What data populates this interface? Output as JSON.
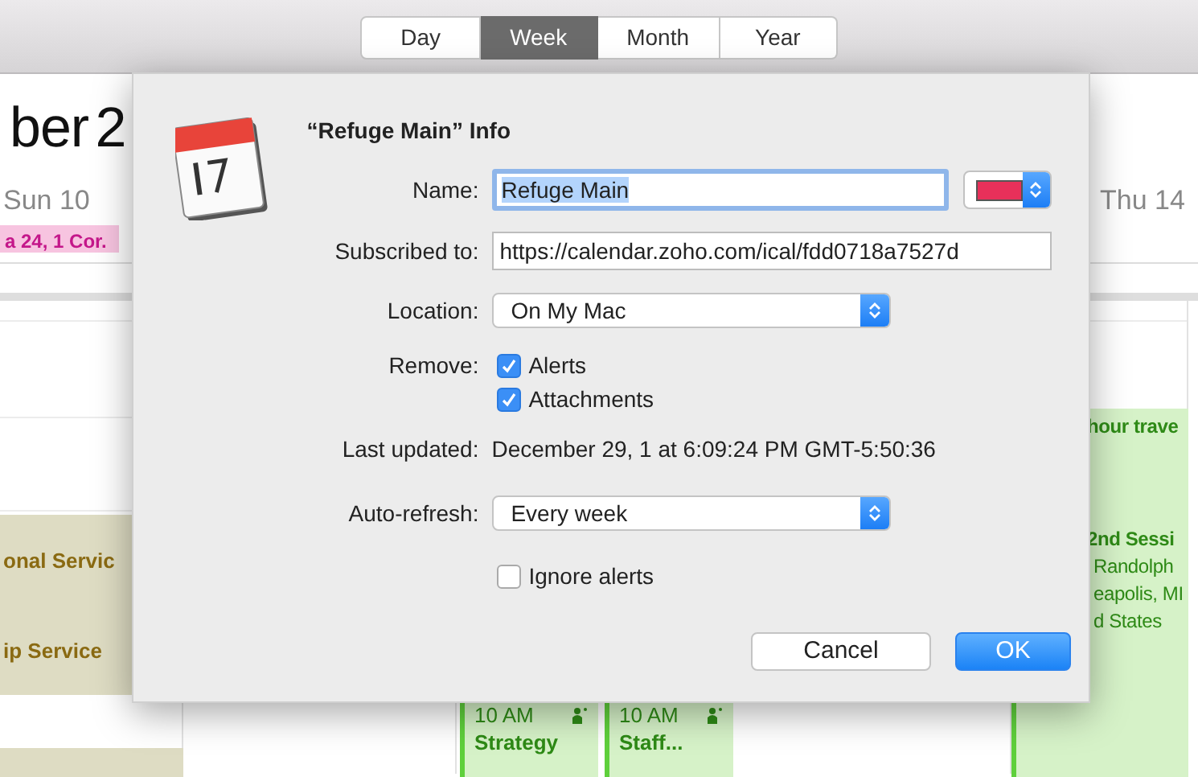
{
  "toolbar": {
    "view_tabs": [
      {
        "label": "Day",
        "selected": false
      },
      {
        "label": "Week",
        "selected": true
      },
      {
        "label": "Month",
        "selected": false
      },
      {
        "label": "Year",
        "selected": false
      }
    ]
  },
  "calendar": {
    "title": "ber 2",
    "columns": [
      {
        "heading": "Sun 10",
        "all_day": [
          {
            "title": "a 24, 1 Cor.",
            "color": "#f7c4e0"
          }
        ],
        "events": [
          {
            "title": "onal Servic",
            "color": "#dedcc3"
          },
          {
            "title": "ip Service",
            "color": "#dedcc3"
          },
          {
            "color": "#dedcc3"
          }
        ]
      },
      {},
      {
        "events": [
          {
            "time": "10 AM",
            "title": "Strategy",
            "color": "#d6f2c8"
          },
          {
            "time": "10 AM",
            "title": "Staff...",
            "color": "#d6f2c8"
          }
        ]
      },
      {},
      {
        "heading": "Thu 14",
        "events": [
          {
            "title": "hour trave",
            "color": "#d6f2c8"
          },
          {
            "title": "2nd Sessi",
            "location": [
              "Randolph",
              "eapolis, MI",
              "d States"
            ],
            "color": "#d6f2c8"
          },
          {
            "color": "#d6f2c8"
          }
        ]
      }
    ]
  },
  "dialog": {
    "title": "“Refuge Main” Info",
    "fields": [
      {
        "kind": "name",
        "label": "Name:",
        "value": "Refuge Main",
        "color": "#e8305a"
      },
      {
        "kind": "url",
        "label": "Subscribed to:",
        "value": "https://calendar.zoho.com/ical/fdd0718a7527d"
      },
      {
        "kind": "popup",
        "label": "Location:",
        "value": "On My Mac"
      },
      {
        "kind": "checks",
        "label": "Remove:",
        "options": [
          {
            "label": "Alerts",
            "checked": true
          },
          {
            "label": "Attachments",
            "checked": true
          }
        ]
      },
      {
        "kind": "text",
        "label": "Last updated:",
        "value": "December 29, 1 at 6:09:24 PM GMT-5:50:36"
      },
      {
        "kind": "popup",
        "label": "Auto-refresh:",
        "value": "Every week"
      },
      {
        "kind": "checks",
        "options": [
          {
            "label": "Ignore alerts",
            "checked": false
          }
        ]
      }
    ],
    "buttons": [
      {
        "label": "Cancel",
        "default": false
      },
      {
        "label": "OK",
        "default": true
      }
    ]
  }
}
